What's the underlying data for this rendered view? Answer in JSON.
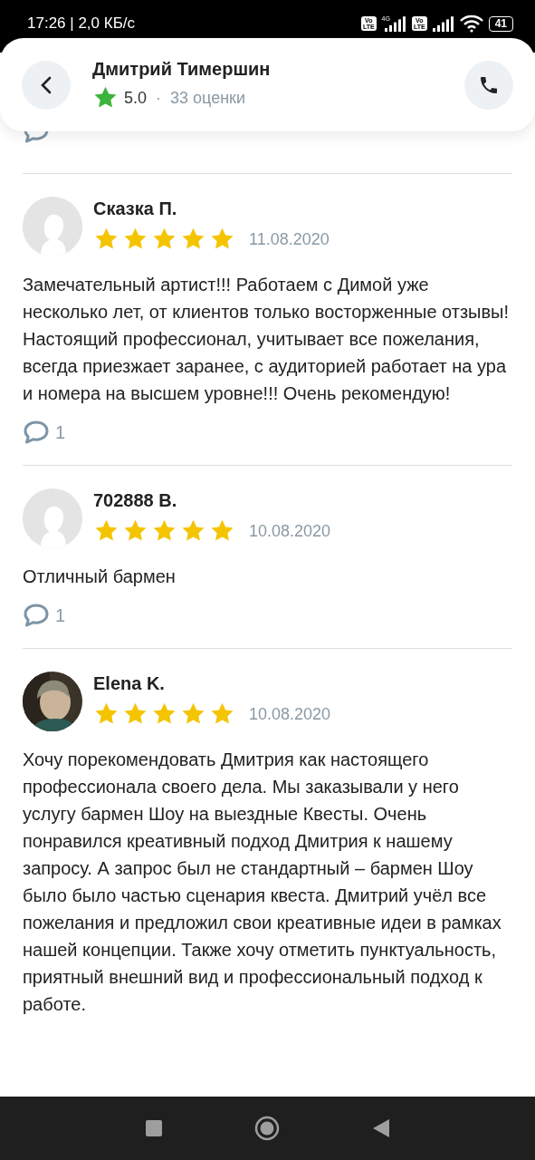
{
  "status_bar": {
    "time": "17:26 | 2,0 КБ/с",
    "sims": [
      {
        "badge_top": "Vo",
        "badge_bottom": "LTE",
        "network": "4G"
      },
      {
        "badge_top": "Vo",
        "badge_bottom": "LTE"
      }
    ],
    "battery": "41"
  },
  "header": {
    "title": "Дмитрий Тимершин",
    "rating": "5.0",
    "separator": "·",
    "ratings_count": "33 оценки"
  },
  "reviews": [
    {
      "author": "Сказка П.",
      "avatar": {
        "kind": "silhouette"
      },
      "stars": 5,
      "date": "11.08.2020",
      "text": "Замечательный артист!!! Работаем с Димой уже несколько лет, от клиентов только восторженные отзывы!Настоящий профессионал, учитывает все пожелания, всегда приезжает заранее, с аудиторией работает на ура и номера на высшем уровне!!! Очень рекомендую!",
      "comments": "1"
    },
    {
      "author": "702888 В.",
      "avatar": {
        "kind": "silhouette"
      },
      "stars": 5,
      "date": "10.08.2020",
      "text": "Отличный бармен",
      "comments": "1"
    },
    {
      "author": "Elena K.",
      "stars": 5,
      "date": "10.08.2020",
      "text": "Хочу порекомендовать Дмитрия как настоящего профессионала своего дела. Мы заказывали у него услугу бармен Шоу на выездные Квесты. Очень понравился креативный подход Дмитрия к нашему запросу. А запрос был не стандартный – бармен Шоу было было частью сценария квеста. Дмитрий учёл все пожелания и предложил свои креативные идеи в рамках нашей концепции. Также хочу отметить пунктуальность, приятный внешний вид и профессиональный подход к работе."
    }
  ]
}
